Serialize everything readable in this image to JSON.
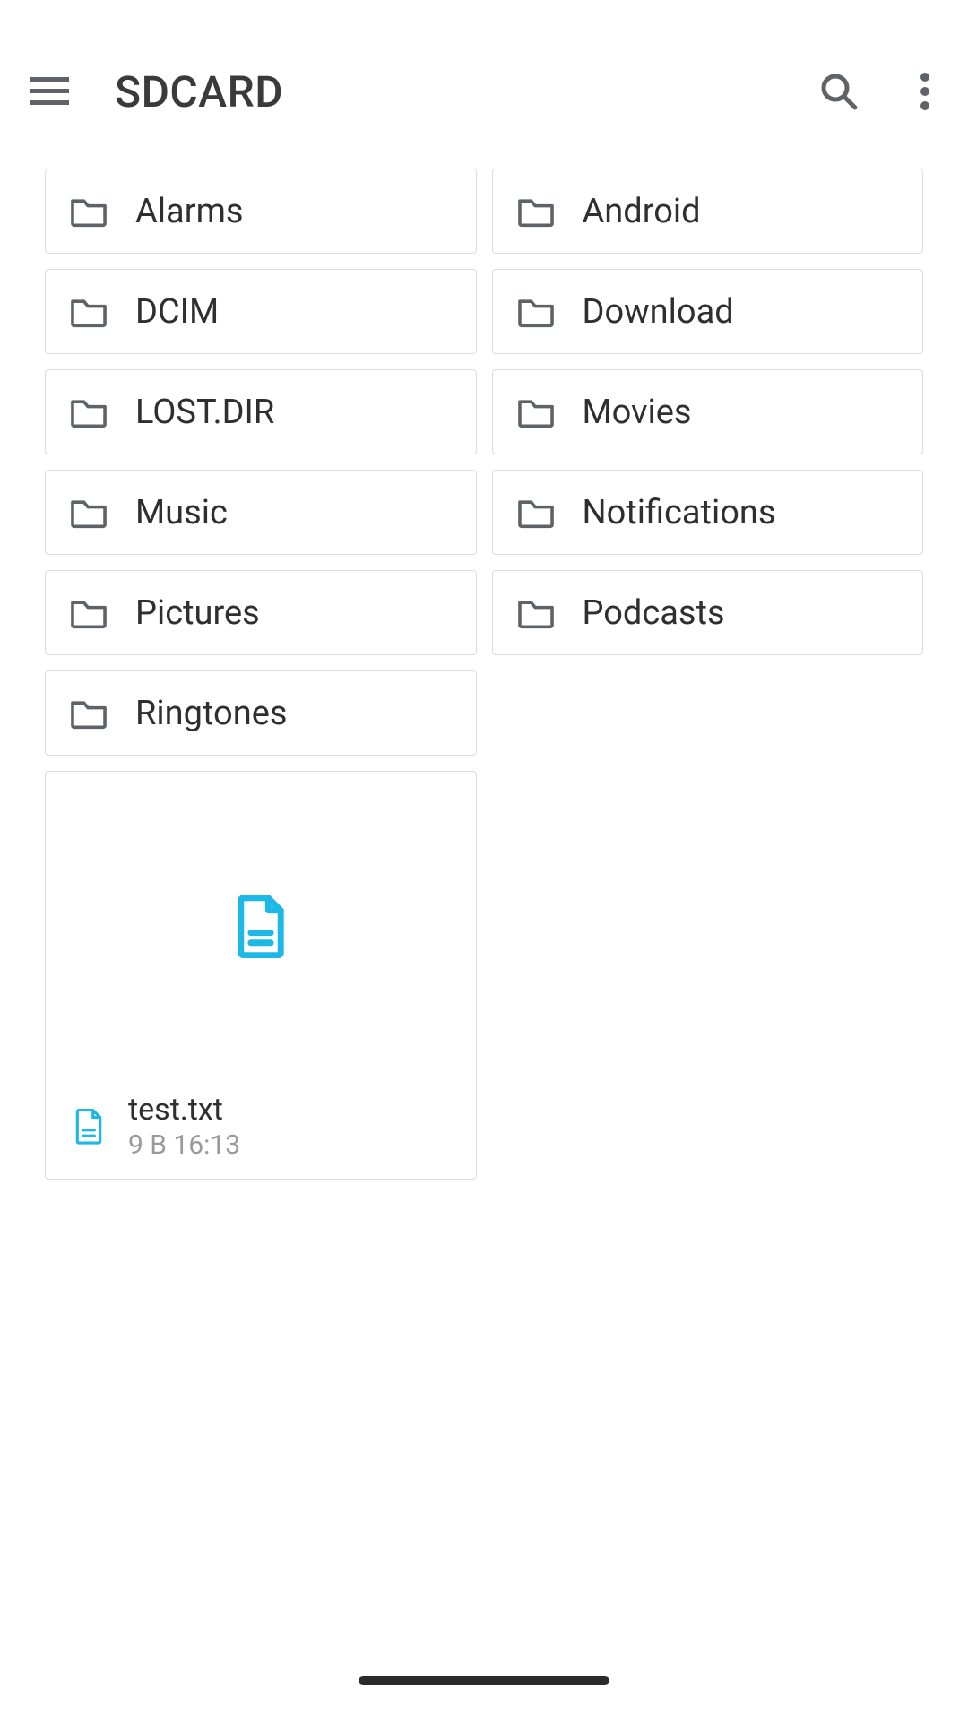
{
  "appbar": {
    "title": "SDCARD",
    "menu_icon": "menu-icon",
    "search_icon": "search-icon",
    "more_icon": "more-vert-icon"
  },
  "folders": [
    {
      "name": "Alarms"
    },
    {
      "name": "Android"
    },
    {
      "name": "DCIM"
    },
    {
      "name": "Download"
    },
    {
      "name": "LOST.DIR"
    },
    {
      "name": "Movies"
    },
    {
      "name": "Music"
    },
    {
      "name": "Notifications"
    },
    {
      "name": "Pictures"
    },
    {
      "name": "Podcasts"
    },
    {
      "name": "Ringtones"
    }
  ],
  "files": [
    {
      "name": "test.txt",
      "meta": "9 B 16:13"
    }
  ],
  "colors": {
    "accent": "#1eb8e6",
    "border": "#dcdcdc",
    "text": "#2f2f2f",
    "text_secondary": "#9a9a9a",
    "icon_gray": "#5f6368"
  }
}
